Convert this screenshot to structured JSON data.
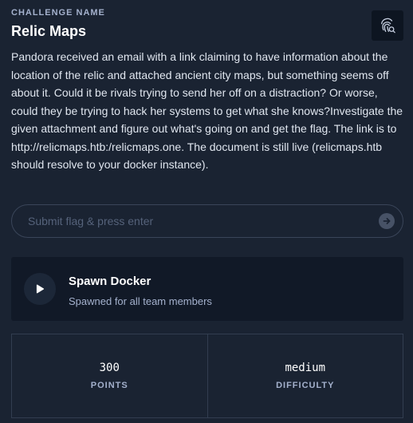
{
  "challenge": {
    "section_label": "CHALLENGE NAME",
    "name": "Relic Maps",
    "fingerprint_icon": "fingerprint-search-icon",
    "description": "Pandora received an email with a link claiming to have information about the location of the relic and attached ancient city maps, but something seems off about it. Could it be rivals trying to send her off on a distraction? Or worse, could they be trying to hack her systems to get what she knows?Investigate the given attachment and figure out what's going on and get the flag. The link is to http://relicmaps.htb:/relicmaps.one. The document is still live (relicmaps.htb should resolve to your docker instance)."
  },
  "flag": {
    "value": "",
    "placeholder": "Submit flag & press enter",
    "submit_icon": "arrow-right-circle-icon"
  },
  "docker": {
    "play_icon": "play-icon",
    "title": "Spawn Docker",
    "subtitle": "Spawned for all team members"
  },
  "stats": {
    "points_value": "300",
    "points_label": "POINTS",
    "difficulty_value": "medium",
    "difficulty_label": "DIFFICULTY"
  },
  "colors": {
    "background": "#1a2332",
    "card": "#111927",
    "border": "#323d50",
    "muted_text": "#a4b1cd"
  }
}
